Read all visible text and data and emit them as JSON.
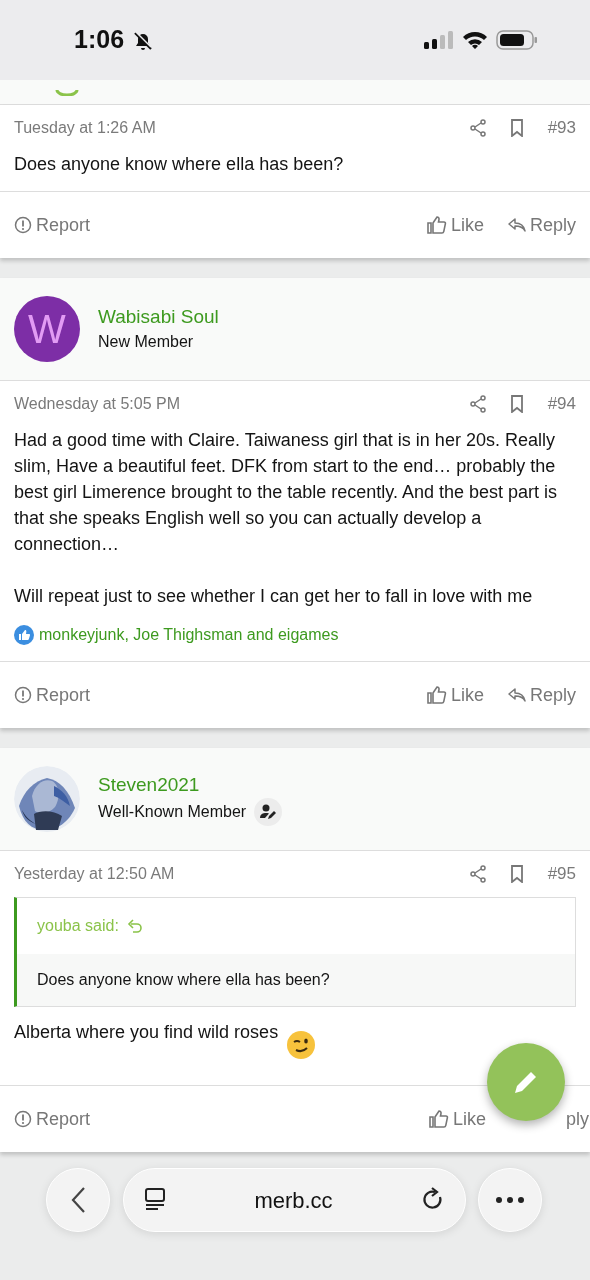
{
  "status_bar": {
    "time": "1:06",
    "silent": true
  },
  "posts": [
    {
      "date": "Tuesday at 1:26 AM",
      "number": "#93",
      "body": [
        "Does anyone know where ella has been?"
      ],
      "emoji": false,
      "actions": {
        "report": "Report",
        "like": "Like",
        "reply": "Reply",
        "reply_icon": true
      }
    },
    {
      "author": {
        "name": "Wabisabi Soul",
        "title": "New Member",
        "avatar": {
          "kind": "letter",
          "letter": "W",
          "color": "#7d2ea6"
        },
        "badge_icon": false
      },
      "date": "Wednesday at 5:05 PM",
      "number": "#94",
      "body": [
        "Had a good time with Claire. Taiwaness girl that is in her 20s. Really slim, Have a beautiful feet. DFK from start to the end… probably the best girl Limerence brought to the table recently. And the best part is that she speaks English well so you can actually develop a connection…",
        "Will repeat just to see whether I can get her to fall in love with me"
      ],
      "emoji": false,
      "reactions": "monkeyjunk, Joe Thighsman and eigames",
      "actions": {
        "report": "Report",
        "like": "Like",
        "reply": "Reply",
        "reply_icon": true
      }
    },
    {
      "author": {
        "name": "Steven2021",
        "title": "Well-Known Member",
        "badge_icon": true
      },
      "date": "Yesterday at 12:50 AM",
      "number": "#95",
      "quote": {
        "author": "youba said:",
        "text": "Does anyone know where ella has been?"
      },
      "body": [
        "Alberta where you find wild roses"
      ],
      "emoji": true,
      "actions": {
        "report": "Report",
        "like": "Like",
        "reply": "ply",
        "reply_icon": false
      }
    }
  ],
  "browser_bar": {
    "url": "merb.cc"
  }
}
